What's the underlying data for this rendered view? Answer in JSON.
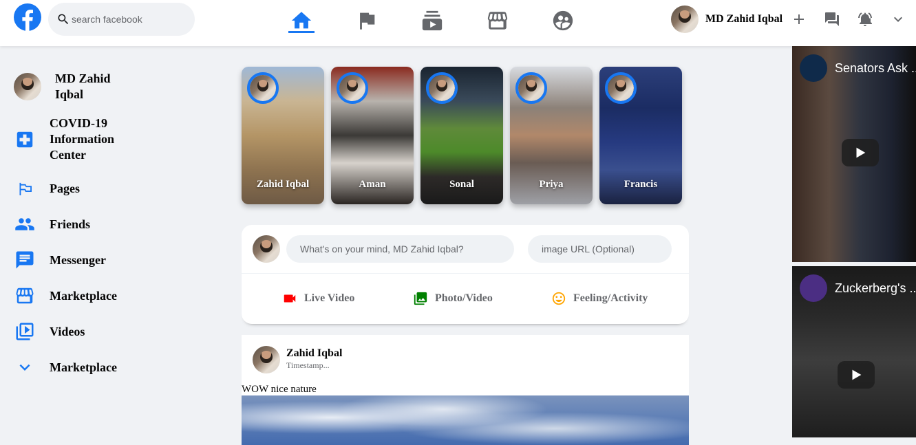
{
  "header": {
    "search_placeholder": "search facebook",
    "user_name": "MD Zahid Iqbal",
    "brand_color": "#1877f2",
    "nav_icons": [
      "home-icon",
      "flag-icon",
      "subscriptions-icon",
      "storefront-icon",
      "supervised-user-icon"
    ]
  },
  "sidebar": {
    "user": "MD Zahid Iqbal",
    "items": [
      {
        "label": "COVID-19 Information Center",
        "icon": "local-hospital-icon"
      },
      {
        "label": "Pages",
        "icon": "emoji-flags-icon"
      },
      {
        "label": "Friends",
        "icon": "people-icon"
      },
      {
        "label": "Messenger",
        "icon": "chat-icon"
      },
      {
        "label": "Marketplace",
        "icon": "storefront-icon"
      },
      {
        "label": "Videos",
        "icon": "video-library-icon"
      },
      {
        "label": "Marketplace",
        "icon": "expand-more-icon"
      }
    ]
  },
  "stories": [
    {
      "name": "Zahid Iqbal"
    },
    {
      "name": "Aman"
    },
    {
      "name": "Sonal"
    },
    {
      "name": "Priya"
    },
    {
      "name": "Francis"
    }
  ],
  "composer": {
    "text_placeholder": "What's on your mind, MD Zahid Iqbal?",
    "image_placeholder": "image URL (Optional)",
    "options": [
      {
        "label": "Live Video",
        "color": "#ff0000"
      },
      {
        "label": "Photo/Video",
        "color": "#008000"
      },
      {
        "label": "Feeling/Activity",
        "color": "#ffa500"
      }
    ]
  },
  "post": {
    "author": "Zahid Iqbal",
    "timestamp": "Timestamp...",
    "message": "WOW nice nature"
  },
  "videos": [
    {
      "title": "Senators Ask ..."
    },
    {
      "title": "Zuckerberg's ..."
    }
  ]
}
